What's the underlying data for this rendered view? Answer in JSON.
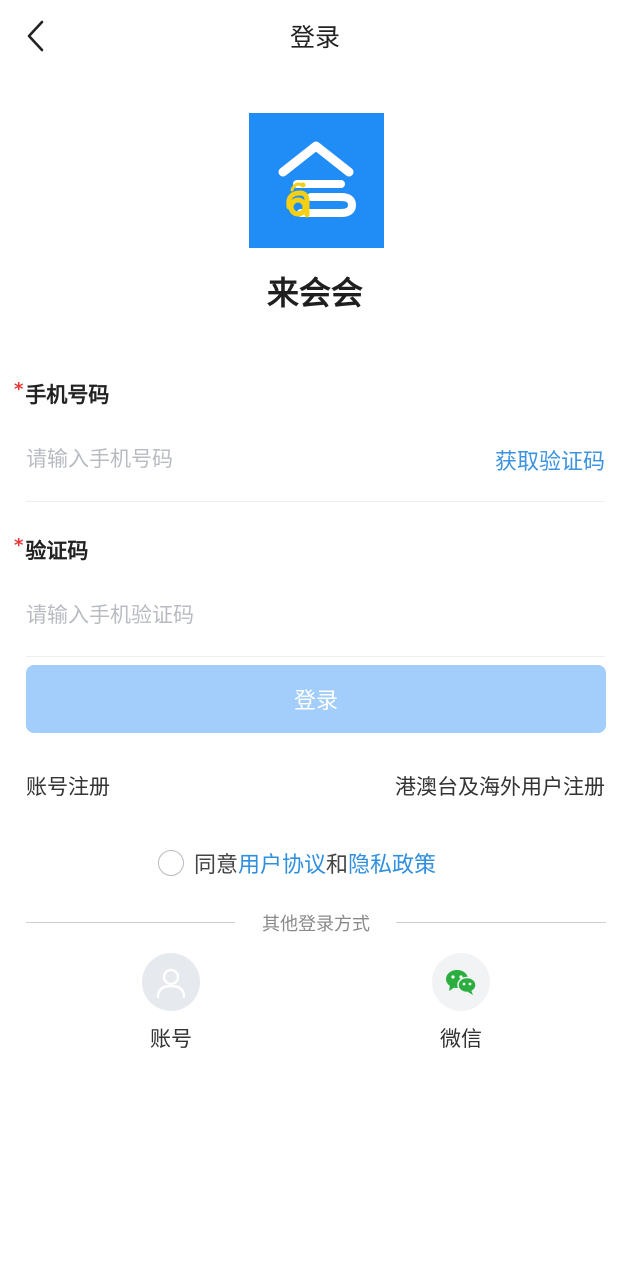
{
  "header": {
    "back_icon": "chevron-left-icon",
    "title": "登录"
  },
  "app": {
    "name": "来会会",
    "logo_color": "#1f8df5"
  },
  "form": {
    "phone": {
      "required_mark": "*",
      "label": "手机号码",
      "placeholder": "请输入手机号码",
      "value": "",
      "get_code_label": "获取验证码"
    },
    "code": {
      "required_mark": "*",
      "label": "验证码",
      "placeholder": "请输入手机验证码",
      "value": ""
    },
    "login_button": "登录"
  },
  "links": {
    "register": "账号注册",
    "overseas_register": "港澳台及海外用户注册"
  },
  "agreement": {
    "checked": false,
    "prefix": "同意",
    "user_agreement": "用户协议",
    "and": "和",
    "privacy_policy": "隐私政策"
  },
  "other_login": {
    "title": "其他登录方式",
    "methods": [
      {
        "label": "账号",
        "icon": "user-icon"
      },
      {
        "label": "微信",
        "icon": "wechat-icon"
      }
    ]
  },
  "colors": {
    "accent": "#3d93e0",
    "login_button_disabled": "#a3cdfa",
    "required": "#e53935",
    "wechat_green": "#2aae3e"
  }
}
